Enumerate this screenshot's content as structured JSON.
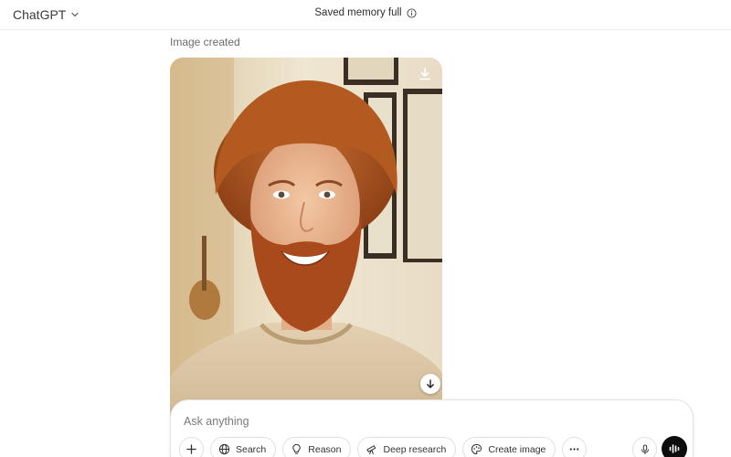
{
  "header": {
    "model_name": "ChatGPT",
    "memory_status": "Saved memory full"
  },
  "message": {
    "caption": "Image created",
    "image_subject": "portrait of a smiling man with curly red hair and beard in a beige sweater"
  },
  "composer": {
    "placeholder": "Ask anything",
    "tools": [
      {
        "label": "Search",
        "icon": "globe-icon"
      },
      {
        "label": "Reason",
        "icon": "lightbulb-icon"
      },
      {
        "label": "Deep research",
        "icon": "telescope-icon"
      },
      {
        "label": "Create image",
        "icon": "palette-icon"
      }
    ]
  },
  "colors": {
    "accent_dark": "#0d0d0d",
    "border": "#e3e3e3",
    "muted_text": "#6b6b6b"
  }
}
